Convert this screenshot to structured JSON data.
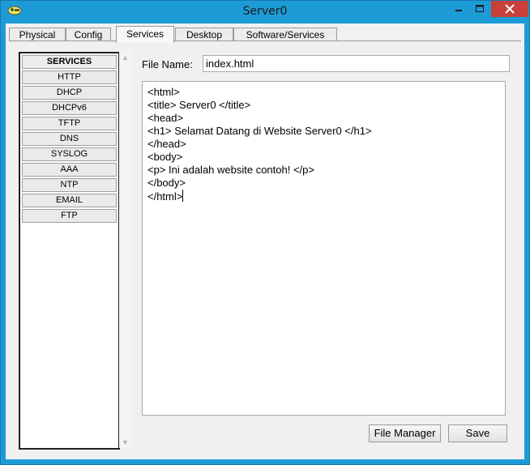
{
  "window": {
    "title": "Server0",
    "controls": {
      "minimize_icon": "minimize-icon",
      "maximize_icon": "maximize-icon",
      "close_icon": "close-icon"
    }
  },
  "tabs": [
    {
      "label": "Physical"
    },
    {
      "label": "Config"
    },
    {
      "label": "Services",
      "active": true
    },
    {
      "label": "Desktop"
    },
    {
      "label": "Software/Services"
    }
  ],
  "services": {
    "header": "SERVICES",
    "items": [
      "HTTP",
      "DHCP",
      "DHCPv6",
      "TFTP",
      "DNS",
      "SYSLOG",
      "AAA",
      "NTP",
      "EMAIL",
      "FTP"
    ]
  },
  "file": {
    "label": "File Name:",
    "name": "index.html"
  },
  "editor": {
    "lines": [
      "<html>",
      "<title> Server0 </title>",
      "<head>",
      "<h1> Selamat Datang di Website Server0 </h1>",
      "</head>",
      "<body>",
      "<p> Ini adalah website contoh! </p>",
      "</body>",
      "</html>"
    ]
  },
  "buttons": {
    "file_manager": "File Manager",
    "save": "Save"
  },
  "colors": {
    "title_bar": "#1d9bd7",
    "close_button": "#c7403a",
    "panel_bg": "#f0f0f0"
  }
}
